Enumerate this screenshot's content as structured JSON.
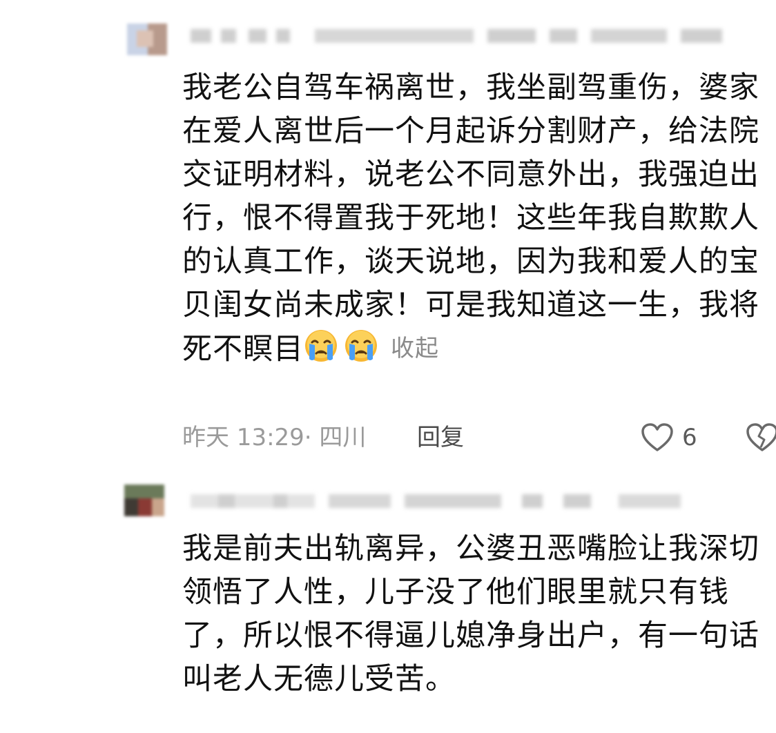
{
  "comments": [
    {
      "text_before_emoji": "我老公自驾车祸离世，我坐副驾重伤，婆家在爱人离世后一个月起诉分割财产，给法院交证明材料，说老公不同意外出，我强迫出行，恨不得置我于死地！这些年我自欺欺人的认真工作，谈天说地，因为我和爱人的宝贝闺女尚未成家！可是我知道这一生，我将死不瞑目",
      "emoji_icons": [
        "crying-face-icon",
        "crying-face-icon"
      ],
      "collapse_label": "收起",
      "timestamp_location": "昨天 13:29· 四川",
      "reply_label": "回复",
      "like_count": "6"
    },
    {
      "text": "我是前夫出轨离异，公婆丑恶嘴脸让我深切领悟了人性，儿子没了他们眼里就只有钱了，所以恨不得逼儿媳净身出户，有一句话叫老人无德儿受苦。"
    }
  ],
  "colors": {
    "text": "#111111",
    "meta_gray": "#9a9a9a",
    "reply_dark": "#4a4a4a",
    "emoji_yellow": "#f7b733",
    "tear_blue": "#4a9ff5"
  }
}
